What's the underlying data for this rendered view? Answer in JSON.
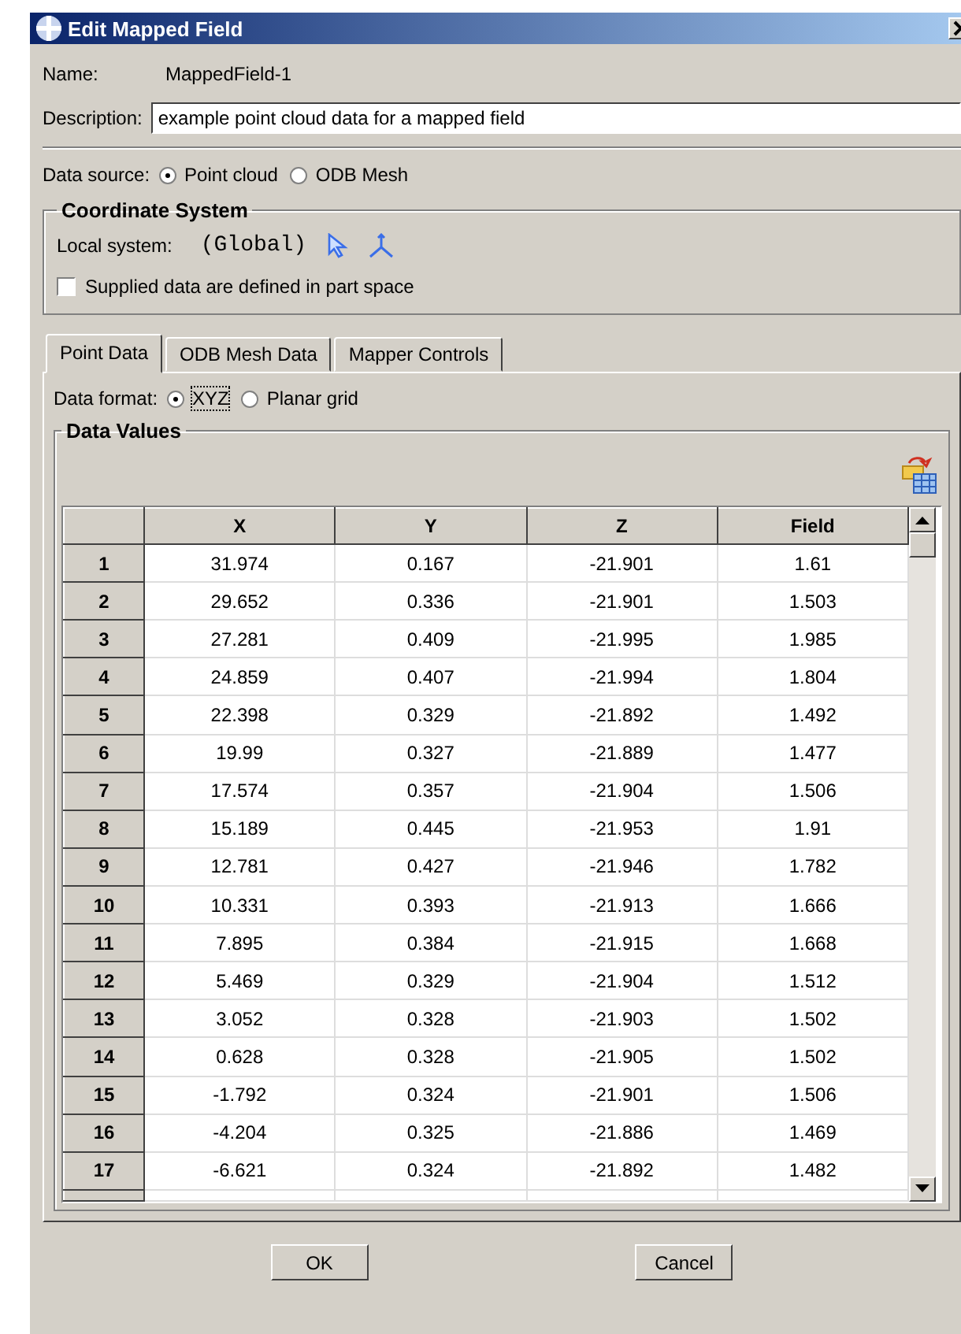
{
  "window": {
    "title": "Edit Mapped Field"
  },
  "name": {
    "label": "Name:",
    "value": "MappedField-1"
  },
  "description": {
    "label": "Description:",
    "value": "example point cloud data for a mapped field"
  },
  "data_source": {
    "label": "Data source:",
    "options": [
      {
        "label": "Point cloud",
        "selected": true
      },
      {
        "label": "ODB Mesh",
        "selected": false
      }
    ]
  },
  "coordinate_system": {
    "title": "Coordinate System",
    "local_system_label": "Local system:",
    "local_system_value": "(Global)",
    "part_space": {
      "label": "Supplied data are defined in part space",
      "checked": false
    }
  },
  "tabs": [
    {
      "label": "Point Data",
      "selected": true
    },
    {
      "label": "ODB Mesh Data",
      "selected": false
    },
    {
      "label": "Mapper Controls",
      "selected": false
    }
  ],
  "data_format": {
    "label": "Data format:",
    "options": [
      {
        "label": "XYZ",
        "selected": true
      },
      {
        "label": "Planar grid",
        "selected": false
      }
    ]
  },
  "data_values": {
    "title": "Data Values",
    "table": {
      "columns": [
        "X",
        "Y",
        "Z",
        "Field"
      ],
      "rows": [
        {
          "index": "1",
          "cells": [
            "31.974",
            "0.167",
            "-21.901",
            "1.61"
          ]
        },
        {
          "index": "2",
          "cells": [
            "29.652",
            "0.336",
            "-21.901",
            "1.503"
          ]
        },
        {
          "index": "3",
          "cells": [
            "27.281",
            "0.409",
            "-21.995",
            "1.985"
          ]
        },
        {
          "index": "4",
          "cells": [
            "24.859",
            "0.407",
            "-21.994",
            "1.804"
          ]
        },
        {
          "index": "5",
          "cells": [
            "22.398",
            "0.329",
            "-21.892",
            "1.492"
          ]
        },
        {
          "index": "6",
          "cells": [
            "19.99",
            "0.327",
            "-21.889",
            "1.477"
          ]
        },
        {
          "index": "7",
          "cells": [
            "17.574",
            "0.357",
            "-21.904",
            "1.506"
          ]
        },
        {
          "index": "8",
          "cells": [
            "15.189",
            "0.445",
            "-21.953",
            "1.91"
          ]
        },
        {
          "index": "9",
          "cells": [
            "12.781",
            "0.427",
            "-21.946",
            "1.782"
          ]
        },
        {
          "index": "10",
          "cells": [
            "10.331",
            "0.393",
            "-21.913",
            "1.666"
          ]
        },
        {
          "index": "11",
          "cells": [
            "7.895",
            "0.384",
            "-21.915",
            "1.668"
          ]
        },
        {
          "index": "12",
          "cells": [
            "5.469",
            "0.329",
            "-21.904",
            "1.512"
          ]
        },
        {
          "index": "13",
          "cells": [
            "3.052",
            "0.328",
            "-21.903",
            "1.502"
          ]
        },
        {
          "index": "14",
          "cells": [
            "0.628",
            "0.328",
            "-21.905",
            "1.502"
          ]
        },
        {
          "index": "15",
          "cells": [
            "-1.792",
            "0.324",
            "-21.901",
            "1.506"
          ]
        },
        {
          "index": "16",
          "cells": [
            "-4.204",
            "0.325",
            "-21.886",
            "1.469"
          ]
        },
        {
          "index": "17",
          "cells": [
            "-6.621",
            "0.324",
            "-21.892",
            "1.482"
          ]
        }
      ]
    }
  },
  "buttons": [
    "OK",
    "Cancel"
  ]
}
